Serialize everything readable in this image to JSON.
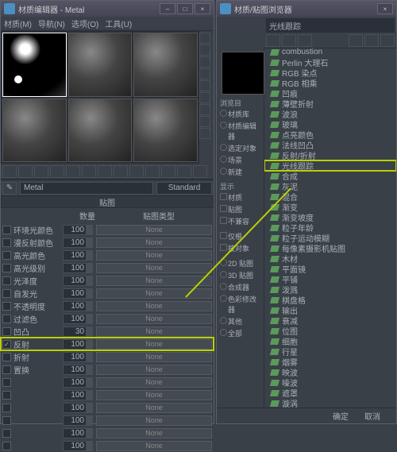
{
  "editor": {
    "title": "材质编辑器 - Metal",
    "menu": [
      "材质(M)",
      "导航(N)",
      "选项(O)",
      "工具(U)"
    ],
    "name_field": "Metal",
    "shader_btn": "Standard",
    "section_title": "贴图",
    "col_amount": "数量",
    "col_maptype": "贴图类型",
    "rows": [
      {
        "label": "环境光颜色",
        "amt": "100",
        "map": "None",
        "checked": false
      },
      {
        "label": "漫反射颜色",
        "amt": "100",
        "map": "None",
        "checked": false
      },
      {
        "label": "高光颜色",
        "amt": "100",
        "map": "None",
        "checked": false
      },
      {
        "label": "高光级别",
        "amt": "100",
        "map": "None",
        "checked": false
      },
      {
        "label": "光泽度",
        "amt": "100",
        "map": "None",
        "checked": false
      },
      {
        "label": "自发光",
        "amt": "100",
        "map": "None",
        "checked": false
      },
      {
        "label": "不透明度",
        "amt": "100",
        "map": "None",
        "checked": false
      },
      {
        "label": "过滤色",
        "amt": "100",
        "map": "None",
        "checked": false
      },
      {
        "label": "凹凸",
        "amt": "30",
        "map": "None",
        "checked": false
      },
      {
        "label": "反射",
        "amt": "100",
        "map": "None",
        "checked": true,
        "hl": true
      },
      {
        "label": "折射",
        "amt": "100",
        "map": "None",
        "checked": false
      },
      {
        "label": "置换",
        "amt": "100",
        "map": "None",
        "checked": false
      },
      {
        "label": "",
        "amt": "100",
        "map": "None",
        "checked": false
      },
      {
        "label": "",
        "amt": "100",
        "map": "None",
        "checked": false
      },
      {
        "label": "",
        "amt": "100",
        "map": "None",
        "checked": false
      },
      {
        "label": "",
        "amt": "100",
        "map": "None",
        "checked": false
      },
      {
        "label": "",
        "amt": "100",
        "map": "None",
        "checked": false
      },
      {
        "label": "",
        "amt": "100",
        "map": "None",
        "checked": false
      }
    ]
  },
  "browser": {
    "title": "材质/贴图浏览器",
    "search": "光线跟踪",
    "side": {
      "g1": "浏览目",
      "g1items": [
        "材质库",
        "材质编辑器",
        "选定对象",
        "场景",
        "新建"
      ],
      "g2": "显示",
      "g2items": [
        "材质",
        "贴图",
        "不兼容"
      ],
      "g3items": [
        "仅根",
        "按对象"
      ],
      "g4items": [
        "2D 贴图",
        "3D 贴图",
        "合成器",
        "色彩修改器",
        "其他",
        "全部"
      ]
    },
    "tree": [
      {
        "t": "combustion"
      },
      {
        "t": "Perlin 大理石"
      },
      {
        "t": "RGB 染点"
      },
      {
        "t": "RGB 相乘"
      },
      {
        "t": "凹痕"
      },
      {
        "t": "薄壁折射"
      },
      {
        "t": "波浪"
      },
      {
        "t": "玻璃"
      },
      {
        "t": "点亮颜色"
      },
      {
        "t": "法线凹凸"
      },
      {
        "t": "反射/折射"
      },
      {
        "t": "光线跟踪",
        "hl": true
      },
      {
        "t": "合成"
      },
      {
        "t": "灰泥"
      },
      {
        "t": "混合"
      },
      {
        "t": "渐变"
      },
      {
        "t": "渐变坡度"
      },
      {
        "t": "粒子年龄"
      },
      {
        "t": "粒子运动模糊"
      },
      {
        "t": "每像素摄影机贴图"
      },
      {
        "t": "木材"
      },
      {
        "t": "平面镜"
      },
      {
        "t": "平铺"
      },
      {
        "t": "泼溅"
      },
      {
        "t": "棋盘格"
      },
      {
        "t": "输出"
      },
      {
        "t": "衰减"
      },
      {
        "t": "位图"
      },
      {
        "t": "细胞"
      },
      {
        "t": "行星"
      },
      {
        "t": "烟雾"
      },
      {
        "t": "映波"
      },
      {
        "t": "噪波"
      },
      {
        "t": "遮罩"
      },
      {
        "t": "漩涡"
      }
    ],
    "ok": "确定",
    "cancel": "取消"
  }
}
